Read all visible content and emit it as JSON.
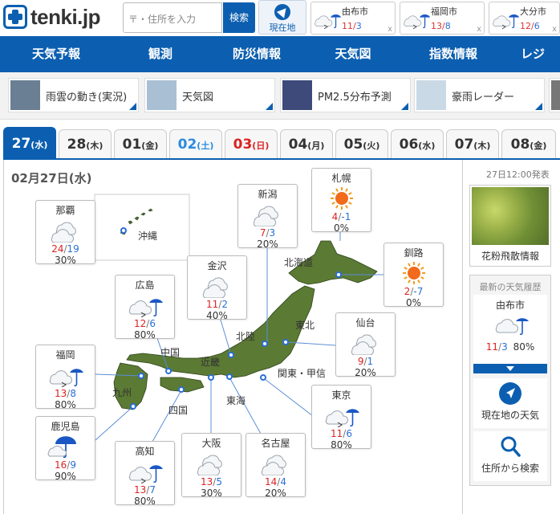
{
  "header": {
    "logo": "tenki.jp",
    "search_placeholder": "〒・住所を入力",
    "search_button": "検索",
    "location_button": "現在地",
    "favorites": [
      {
        "name": "由布市",
        "high": "11",
        "low": "3",
        "close": "x"
      },
      {
        "name": "福岡市",
        "high": "13",
        "low": "8",
        "close": "x"
      },
      {
        "name": "大分市",
        "high": "12",
        "low": "6",
        "close": "x"
      }
    ]
  },
  "nav": [
    "天気予報",
    "観測",
    "防災情報",
    "天気図",
    "指数情報",
    "レジ"
  ],
  "quick_links": [
    "雨雲の動き(実況)",
    "天気図",
    "PM2.5分布予測",
    "豪雨レーダー"
  ],
  "tabs": [
    {
      "day": "27",
      "wd": "(水)",
      "kind": "sel"
    },
    {
      "day": "28",
      "wd": "(木)",
      "kind": ""
    },
    {
      "day": "01",
      "wd": "(金)",
      "kind": ""
    },
    {
      "day": "02",
      "wd": "(土)",
      "kind": "sat"
    },
    {
      "day": "03",
      "wd": "(日)",
      "kind": "sun"
    },
    {
      "day": "04",
      "wd": "(月)",
      "kind": ""
    },
    {
      "day": "05",
      "wd": "(火)",
      "kind": ""
    },
    {
      "day": "06",
      "wd": "(水)",
      "kind": ""
    },
    {
      "day": "07",
      "wd": "(木)",
      "kind": ""
    },
    {
      "day": "08",
      "wd": "(金)",
      "kind": ""
    }
  ],
  "date_heading": "02月27日(水)",
  "announce": "27日12:00発表",
  "cities": [
    {
      "name": "那覇",
      "icon": "cloudy",
      "high": "24",
      "low": "19",
      "pop": "30%"
    },
    {
      "name": "新潟",
      "icon": "cloudy",
      "high": "7",
      "low": "3",
      "pop": "20%"
    },
    {
      "name": "札幌",
      "icon": "sunny",
      "high": "4",
      "low": "-1",
      "pop": "0%"
    },
    {
      "name": "釧路",
      "icon": "sunny",
      "high": "2",
      "low": "-7",
      "pop": "0%"
    },
    {
      "name": "金沢",
      "icon": "cloudy",
      "high": "11",
      "low": "2",
      "pop": "40%"
    },
    {
      "name": "広島",
      "icon": "cloudy-then-rain",
      "high": "12",
      "low": "6",
      "pop": "80%"
    },
    {
      "name": "仙台",
      "icon": "cloudy",
      "high": "9",
      "low": "1",
      "pop": "20%"
    },
    {
      "name": "福岡",
      "icon": "cloudy-then-rain",
      "high": "13",
      "low": "8",
      "pop": "80%"
    },
    {
      "name": "東京",
      "icon": "cloudy-then-rain",
      "high": "11",
      "low": "6",
      "pop": "80%"
    },
    {
      "name": "鹿児島",
      "icon": "rain",
      "high": "16",
      "low": "9",
      "pop": "90%"
    },
    {
      "name": "高知",
      "icon": "cloudy-then-rain",
      "high": "13",
      "low": "7",
      "pop": "80%"
    },
    {
      "name": "大阪",
      "icon": "cloudy",
      "high": "13",
      "low": "5",
      "pop": "30%"
    },
    {
      "name": "名古屋",
      "icon": "cloudy",
      "high": "14",
      "low": "4",
      "pop": "20%"
    }
  ],
  "regions": [
    "沖縄",
    "北海道",
    "東北",
    "北陸",
    "中国",
    "近畿",
    "関東・甲信",
    "九州",
    "東海",
    "四国"
  ],
  "sidebar": {
    "pollen_label": "花粉飛散情報",
    "history_heading": "最新の天気履歴",
    "history_city": "由布市",
    "history_high": "11",
    "history_low": "3",
    "history_pop": "80%",
    "current_location": "現在地の天気",
    "search_address": "住所から検索"
  },
  "colors": {
    "brand": "#0c5fb0",
    "high": "#dd2222",
    "low": "#2a6fd6"
  }
}
